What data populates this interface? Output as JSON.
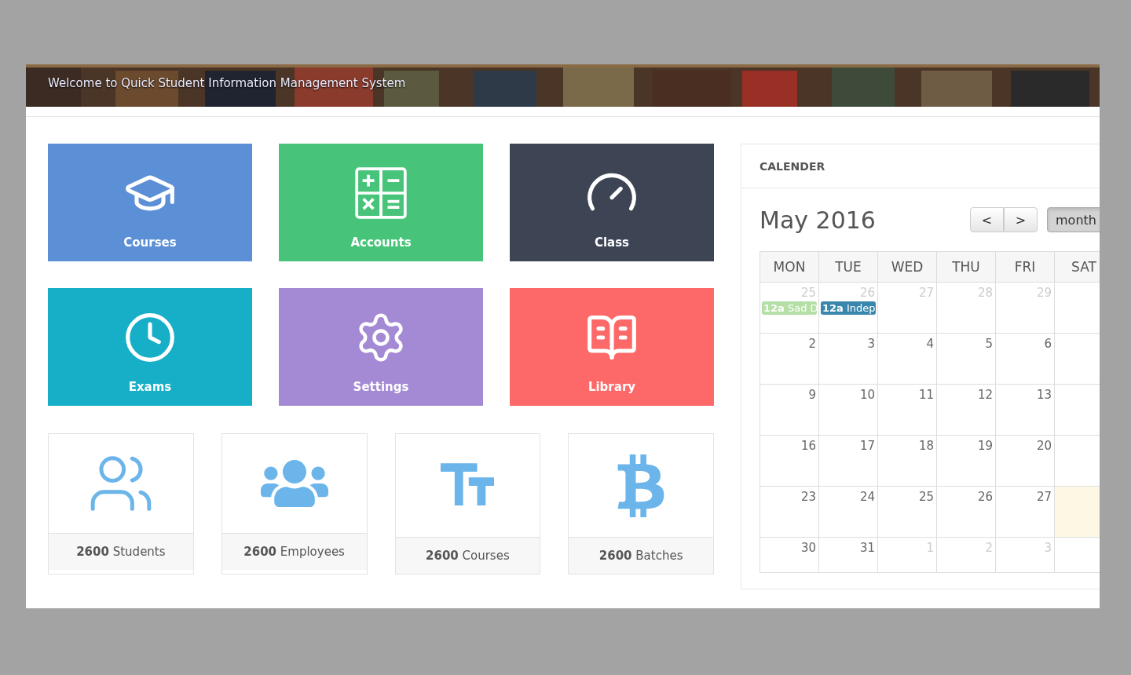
{
  "header": {
    "subtitle": "Welcome to Quick Student Information Management System"
  },
  "tiles": [
    {
      "label": "Courses",
      "color": "#5b8fd6"
    },
    {
      "label": "Accounts",
      "color": "#47c47a"
    },
    {
      "label": "Class",
      "color": "#3d4555"
    },
    {
      "label": "Exams",
      "color": "#17aec7"
    },
    {
      "label": "Settings",
      "color": "#a48ad4"
    },
    {
      "label": "Library",
      "color": "#fd6868"
    }
  ],
  "stats": [
    {
      "count": "2600",
      "label": "Students"
    },
    {
      "count": "2600",
      "label": "Employees"
    },
    {
      "count": "2600",
      "label": "Courses"
    },
    {
      "count": "2600",
      "label": "Batches"
    }
  ],
  "calendar": {
    "title": "CALENDER",
    "month": "May 2016",
    "prev": "<",
    "next": ">",
    "view": "month",
    "weekdays": [
      "MON",
      "TUE",
      "WED",
      "THU",
      "FRI",
      "SAT"
    ],
    "weeks": [
      {
        "days": [
          {
            "date": "25",
            "other_month": true,
            "events": [
              {
                "time": "12a",
                "title": "Sad D",
                "color": "#b5dfa6"
              }
            ]
          },
          {
            "date": "26",
            "other_month": true,
            "events": [
              {
                "time": "12a",
                "title": "Indep",
                "color": "#3a87ad"
              }
            ]
          },
          {
            "date": "27",
            "other_month": true
          },
          {
            "date": "28",
            "other_month": true
          },
          {
            "date": "29",
            "other_month": true
          }
        ],
        "saturday_today": false
      },
      {
        "days": [
          {
            "date": "2",
            "other_month": false
          },
          {
            "date": "3",
            "other_month": false
          },
          {
            "date": "4",
            "other_month": false
          },
          {
            "date": "5",
            "other_month": false
          },
          {
            "date": "6",
            "other_month": false
          }
        ],
        "saturday_today": false
      },
      {
        "days": [
          {
            "date": "9",
            "other_month": false
          },
          {
            "date": "10",
            "other_month": false
          },
          {
            "date": "11",
            "other_month": false
          },
          {
            "date": "12",
            "other_month": false
          },
          {
            "date": "13",
            "other_month": false
          }
        ],
        "saturday_today": false
      },
      {
        "days": [
          {
            "date": "16",
            "other_month": false
          },
          {
            "date": "17",
            "other_month": false
          },
          {
            "date": "18",
            "other_month": false
          },
          {
            "date": "19",
            "other_month": false
          },
          {
            "date": "20",
            "other_month": false
          }
        ],
        "saturday_today": false
      },
      {
        "days": [
          {
            "date": "23",
            "other_month": false
          },
          {
            "date": "24",
            "other_month": false
          },
          {
            "date": "25",
            "other_month": false
          },
          {
            "date": "26",
            "other_month": false
          },
          {
            "date": "27",
            "other_month": false
          }
        ],
        "saturday_today": true
      },
      {
        "days": [
          {
            "date": "30",
            "other_month": false
          },
          {
            "date": "31",
            "other_month": false
          },
          {
            "date": "1",
            "other_month": true
          },
          {
            "date": "2",
            "other_month": true
          },
          {
            "date": "3",
            "other_month": true
          }
        ],
        "saturday_today": false
      }
    ]
  }
}
